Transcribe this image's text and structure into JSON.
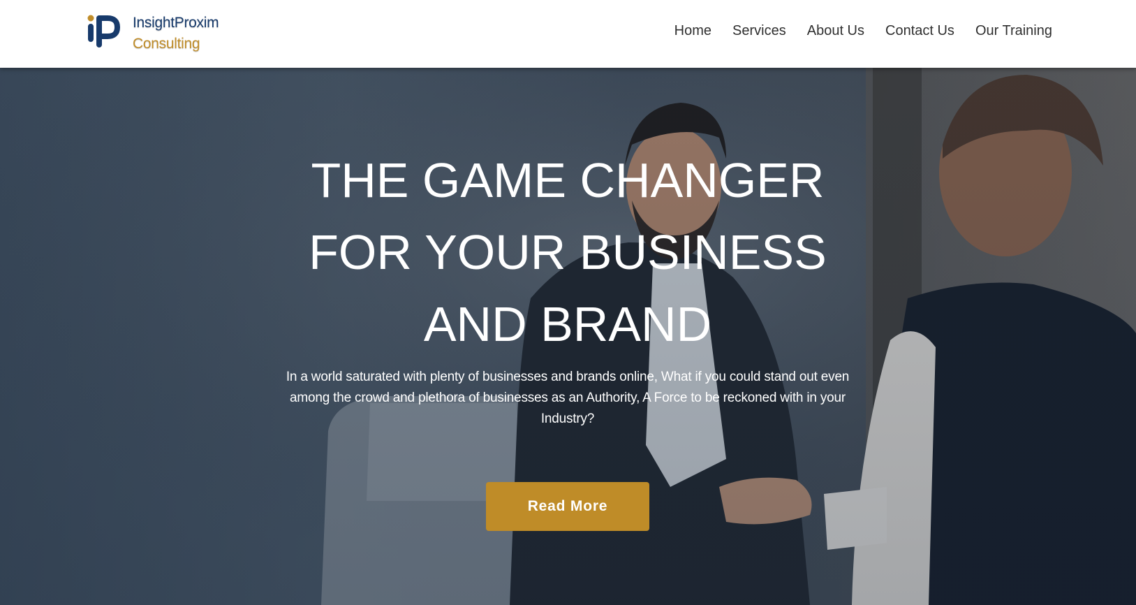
{
  "brand": {
    "name_line1": "InsightProxim",
    "name_line2": "Consulting",
    "logo_icon": "ip-monogram-icon",
    "colors": {
      "navy": "#173a6b",
      "gold": "#c08d2a"
    }
  },
  "nav": {
    "items": [
      {
        "label": "Home"
      },
      {
        "label": "Services"
      },
      {
        "label": "About Us"
      },
      {
        "label": "Contact Us"
      },
      {
        "label": "Our Training"
      }
    ]
  },
  "hero": {
    "title": "THE GAME CHANGER FOR YOUR BUSINESS AND BRAND",
    "text": "In a world saturated with plenty of businesses and brands online, What if you could stand out even among the crowd and plethora of businesses as an Authority, A Force to be reckoned with in your Industry?",
    "button_label": "Read More",
    "button_color": "#bf8c28",
    "image_subject": "two-men-handshake-photo"
  }
}
